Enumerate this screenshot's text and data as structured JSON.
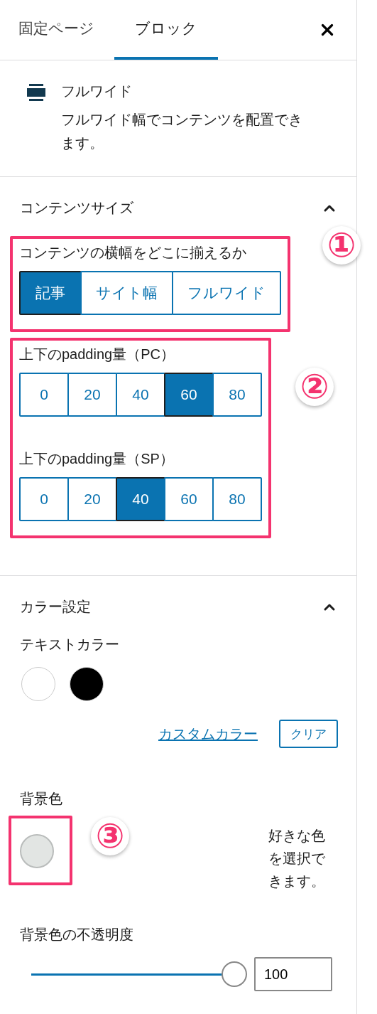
{
  "tabs": [
    {
      "label": "固定ページ",
      "selected": false
    },
    {
      "label": "ブロック",
      "selected": true
    }
  ],
  "block_card": {
    "title": "フルワイド",
    "description": "フルワイド幅でコンテンツを配置できます。"
  },
  "content_size": {
    "title": "コンテンツサイズ",
    "expanded": true,
    "groups": [
      {
        "annotation": "①",
        "fields": [
          {
            "label": "コンテンツの横幅をどこに揃えるか",
            "options": [
              {
                "label": "記事",
                "selected": true
              },
              {
                "label": "サイト幅",
                "selected": false
              },
              {
                "label": "フルワイド",
                "selected": false
              }
            ]
          }
        ]
      },
      {
        "annotation": "②",
        "fields": [
          {
            "label": "上下のpadding量（PC）",
            "options": [
              {
                "label": "0",
                "selected": false
              },
              {
                "label": "20",
                "selected": false
              },
              {
                "label": "40",
                "selected": false
              },
              {
                "label": "60",
                "selected": true
              },
              {
                "label": "80",
                "selected": false
              }
            ]
          },
          {
            "label": "上下のpadding量（SP）",
            "options": [
              {
                "label": "0",
                "selected": false
              },
              {
                "label": "20",
                "selected": false
              },
              {
                "label": "40",
                "selected": true
              },
              {
                "label": "60",
                "selected": false
              },
              {
                "label": "80",
                "selected": false
              }
            ]
          }
        ]
      }
    ]
  },
  "color_settings": {
    "title": "カラー設定",
    "expanded": true,
    "text_color": {
      "label": "テキストカラー",
      "swatches": [
        {
          "color": "#ffffff"
        },
        {
          "color": "#000000"
        }
      ],
      "custom_link": "カスタムカラー",
      "clear_button": "クリア"
    },
    "background": {
      "label": "背景色",
      "annotation": "③",
      "color": "#e2e5e3",
      "help": "好きな色を選択できます。"
    },
    "opacity": {
      "label": "背景色の不透明度",
      "level": 1,
      "value": "100"
    }
  }
}
